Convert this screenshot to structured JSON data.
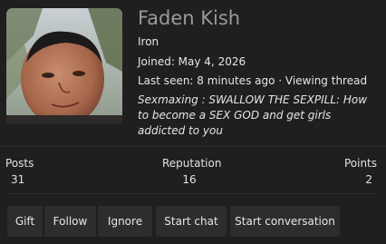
{
  "profile": {
    "username": "Faden Kish",
    "rank": "Iron",
    "joined": "Joined: May 4, 2026",
    "last_seen": "Last seen: 8 minutes ago · Viewing thread",
    "thread_title": "Sexmaxing : SWALLOW THE SEXPILL: How to become a SEX GOD and get girls addicted to you",
    "avatar_icon": "user-avatar-photo"
  },
  "stats": {
    "posts_label": "Posts",
    "posts_value": "31",
    "reputation_label": "Reputation",
    "reputation_value": "16",
    "points_label": "Points",
    "points_value": "2"
  },
  "actions": {
    "gift": "Gift",
    "follow": "Follow",
    "ignore": "Ignore",
    "start_chat": "Start chat",
    "start_conversation": "Start conversation"
  },
  "colors": {
    "background": "#1f1f1f",
    "button": "#2d2d2d",
    "username": "#9a9a9a",
    "text": "#e6e6e6"
  }
}
